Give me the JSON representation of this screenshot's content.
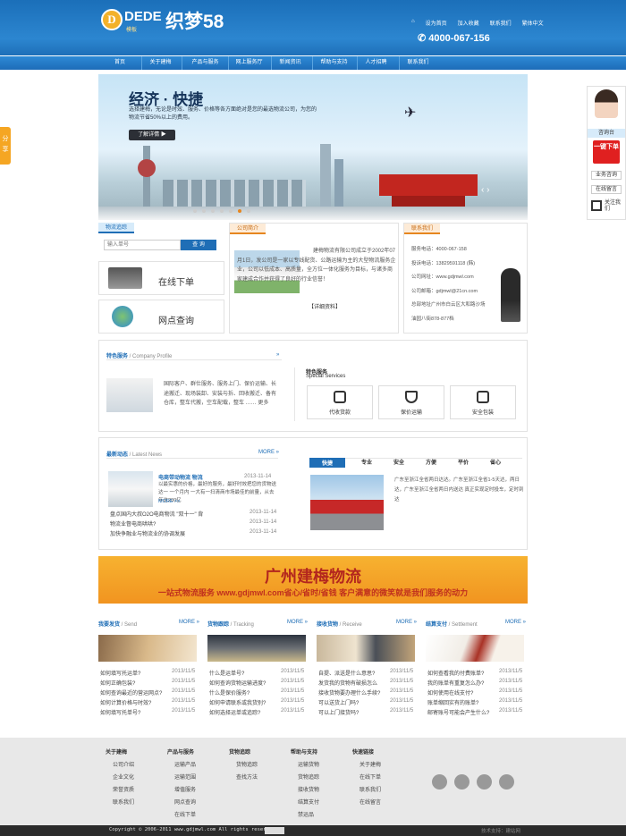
{
  "header": {
    "logo_mark": "D",
    "logo_brand": "DEDE",
    "logo_sub": "模板",
    "logo_cn": "织梦58",
    "top_links": [
      "设为首页",
      "加入收藏",
      "联系我们",
      "繁体中文"
    ],
    "phone": "4000-067-156"
  },
  "nav": [
    "首页",
    "关于建梅",
    "产品与服务",
    "网上服务厅",
    "新闻资讯",
    "帮助与支持",
    "人才招聘",
    "联系我们"
  ],
  "side_share": "分享",
  "right_float": {
    "title": "咨询台",
    "order": "一键下单",
    "items": [
      "业务咨询",
      "在线留言",
      "关注我们"
    ]
  },
  "banner": {
    "title": "经济 · 快捷",
    "text": "选择建梅，无论是时效、服务、价格等各方面绝对是您的最选物流公司，为您的物流节省50%以上的费用。",
    "button": "了解详情 ▶"
  },
  "tracking": {
    "tab": "物流追踪",
    "placeholder": "输入单号",
    "query_btn": "查 询",
    "online_order": "在线下单",
    "outlet_query": "网点查询"
  },
  "company": {
    "tab": "公司简介",
    "text": "建梅物流有限公司成立于2002年07月1日，发公司是一家以专线配货、公路运输为主的大型物流服务企业，公司以低成本、高质量，全方位一体化服务为目标，与诸多商家建成合作并获得了良好的行业信誉！",
    "link": "【详细资料】"
  },
  "contact": {
    "tab": "联系我们",
    "lines": [
      "服务电话：4000-067-158",
      "投诉电话：13829591118 (韩)",
      "公司网址：www.gdjmwl.com",
      "公司邮箱：gdjmwl@21cn.com",
      "总部地址广州市白云区大和路沙场",
      "油园八街878-877档"
    ]
  },
  "features": {
    "title": "特色服务",
    "title_en": " / Company Profile",
    "text": "国际客户、群仕服务、服务上门、保价运输、长途搬迁、现场装卸、安装与拆、回收搬迁、备有仓库，整车代搬，空车配载，整车 …… 更多",
    "right_title": "特色服务",
    "right_title_en": "Special Services",
    "buttons": [
      "代收货款",
      "保价运输",
      "安全包装"
    ]
  },
  "news": {
    "title": "最新动态",
    "title_en": " / Latest News",
    "more": "MORE »",
    "headline": "电商带动物流 物流",
    "headline_date": "2013-11-14",
    "headline_text": "以最实惠的价格，最好的服务，最好时效把您的货物送达一 一个月内 一大有一扫清商市场最佳的前量，从去年这200亿",
    "headline_more": "MORE >>",
    "items": [
      {
        "text": "盘点国内大叔O2O电商物流 \"双十一\" 背",
        "date": "2013-11-14"
      },
      {
        "text": "物流业督电商哄哄?",
        "date": "2013-11-14"
      },
      {
        "text": "加快争融业与物流业的协调发展",
        "date": "2013-11-14"
      }
    ]
  },
  "advantages": {
    "tabs": [
      "快捷",
      "专业",
      "安全",
      "方便",
      "平价",
      "省心"
    ],
    "text": "广东至浙江全省两日达达。广东至浙江全省1-5天达，两日达，广东至浙江全省两日内送达 真正实现定时投车，定时到达"
  },
  "banner2": {
    "title": "广州建梅物流",
    "subtitle": "一站式物流服务 www.gdjmwl.com省心/省时/省钱 客户满意的微笑就是我们服务的动力"
  },
  "columns": [
    {
      "title": "我要发货",
      "title_en": " / Send",
      "more": "MORE »",
      "items": [
        {
          "text": "如何填写托运单?",
          "date": "2013/11/5"
        },
        {
          "text": "如何正确包装?",
          "date": "2013/11/5"
        },
        {
          "text": "如何查询最近的营运网点?",
          "date": "2013/11/5"
        },
        {
          "text": "如何计算价格与时效?",
          "date": "2013/11/5"
        },
        {
          "text": "如何填写托单号?",
          "date": "2013/11/5"
        }
      ]
    },
    {
      "title": "货物跟踪",
      "title_en": " / Tracking",
      "more": "MORE »",
      "items": [
        {
          "text": "什么是运单号?",
          "date": "2013/11/5"
        },
        {
          "text": "如何查询货物运输进度?",
          "date": "2013/11/5"
        },
        {
          "text": "什么是保价服务?",
          "date": "2013/11/5"
        },
        {
          "text": "如何申请联系或我货别?",
          "date": "2013/11/5"
        },
        {
          "text": "如何选择运单或追踪?",
          "date": "2013/11/5"
        }
      ]
    },
    {
      "title": "接收货物",
      "title_en": " / Receive",
      "more": "MORE »",
      "items": [
        {
          "text": "自提、派送是什么意思?",
          "date": "2013/11/5"
        },
        {
          "text": "发货我的货物有破损怎么",
          "date": "2013/11/5"
        },
        {
          "text": "接收货物要办理什么手续?",
          "date": "2013/11/5"
        },
        {
          "text": "可以送货上门吗?",
          "date": "2013/11/5"
        },
        {
          "text": "可以上门接货吗?",
          "date": "2013/11/5"
        }
      ]
    },
    {
      "title": "结算支付",
      "title_en": " / Settlement",
      "more": "MORE »",
      "items": [
        {
          "text": "如何查看我的付费账单?",
          "date": "2013/11/5"
        },
        {
          "text": "我的账单有重复怎么办?",
          "date": "2013/11/5"
        },
        {
          "text": "如何使用在线支付?",
          "date": "2013/11/5"
        },
        {
          "text": "账单缩回实有的账单?",
          "date": "2013/11/5"
        },
        {
          "text": "邮寄账号可能会产生什么?",
          "date": "2013/11/5"
        }
      ]
    }
  ],
  "footer": {
    "cols": [
      {
        "h": "关于建梅",
        "items": [
          "公司介绍",
          "企业文化",
          "荣誉资质",
          "联系我们"
        ]
      },
      {
        "h": "产品与服务",
        "items": [
          "运输产品",
          "运输范围",
          "增值服务",
          "网点查询",
          "在线下单"
        ]
      },
      {
        "h": "货物追踪",
        "items": [
          "货物追踪",
          "查找方法"
        ]
      },
      {
        "h": "帮助与支持",
        "items": [
          "运输货物",
          "货物追踪",
          "接收货物",
          "结算支付",
          "禁运品"
        ]
      },
      {
        "h": "快速链接",
        "items": [
          "关于建梅",
          "在线下单",
          "联系我们",
          "在线留言"
        ]
      }
    ],
    "copyright": "Copyright © 2006-2011 www.gdjmwl.com All rights reserved.",
    "tech": "技术支持：建站网"
  }
}
